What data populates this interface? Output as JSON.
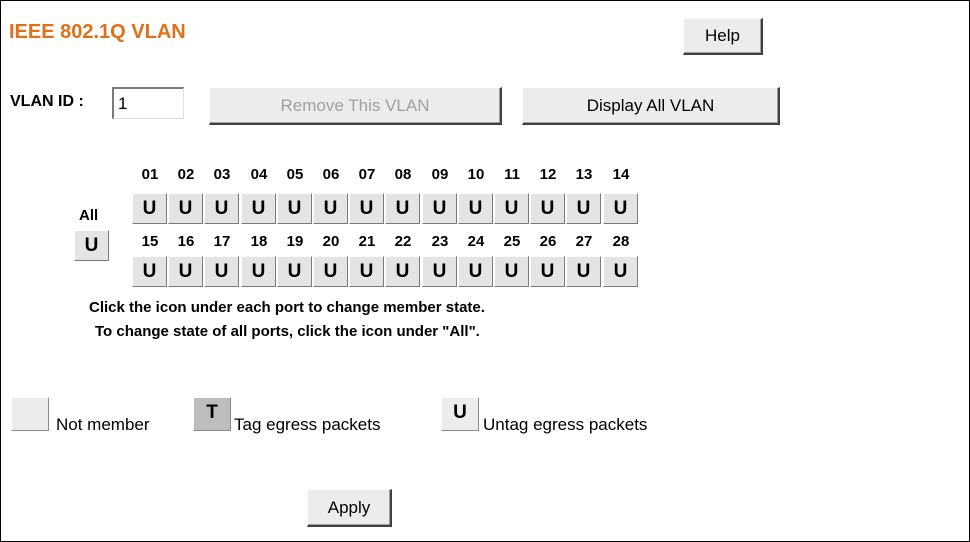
{
  "header": {
    "title": "IEEE 802.1Q VLAN",
    "help_label": "Help"
  },
  "vlan": {
    "id_label": "VLAN ID :",
    "id_value": "1",
    "remove_label": "Remove This VLAN",
    "display_all_label": "Display All VLAN"
  },
  "ports": {
    "all_label": "All",
    "all_state": "U",
    "row1": [
      {
        "number": "01",
        "state": "U"
      },
      {
        "number": "02",
        "state": "U"
      },
      {
        "number": "03",
        "state": "U"
      },
      {
        "number": "04",
        "state": "U"
      },
      {
        "number": "05",
        "state": "U"
      },
      {
        "number": "06",
        "state": "U"
      },
      {
        "number": "07",
        "state": "U"
      },
      {
        "number": "08",
        "state": "U"
      },
      {
        "number": "09",
        "state": "U"
      },
      {
        "number": "10",
        "state": "U"
      },
      {
        "number": "11",
        "state": "U"
      },
      {
        "number": "12",
        "state": "U"
      },
      {
        "number": "13",
        "state": "U"
      },
      {
        "number": "14",
        "state": "U"
      }
    ],
    "row2": [
      {
        "number": "15",
        "state": "U"
      },
      {
        "number": "16",
        "state": "U"
      },
      {
        "number": "17",
        "state": "U"
      },
      {
        "number": "18",
        "state": "U"
      },
      {
        "number": "19",
        "state": "U"
      },
      {
        "number": "20",
        "state": "U"
      },
      {
        "number": "21",
        "state": "U"
      },
      {
        "number": "22",
        "state": "U"
      },
      {
        "number": "23",
        "state": "U"
      },
      {
        "number": "24",
        "state": "U"
      },
      {
        "number": "25",
        "state": "U"
      },
      {
        "number": "26",
        "state": "U"
      },
      {
        "number": "27",
        "state": "U"
      },
      {
        "number": "28",
        "state": "U"
      }
    ]
  },
  "instructions": {
    "line1": "Click the icon under each port to change member state.",
    "line2": "To change state of all ports, click the icon under \"All\"."
  },
  "legend": {
    "not_member": "Not member",
    "tag_symbol": "T",
    "tag_label": "Tag egress packets",
    "untag_symbol": "U",
    "untag_label": "Untag egress packets"
  },
  "footer": {
    "apply_label": "Apply"
  },
  "colors": {
    "title": "#e0701a"
  }
}
